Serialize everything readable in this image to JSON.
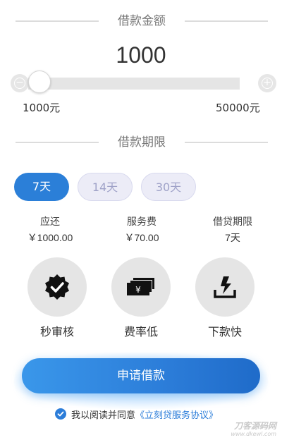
{
  "amount_section": {
    "title": "借款金额",
    "amount": "1000",
    "slider": {
      "min_label": "1000元",
      "max_label": "50000元",
      "min": 1000,
      "max": 50000,
      "value": 1000
    }
  },
  "term_section": {
    "title": "借款期限",
    "options": [
      {
        "label": "7天",
        "selected": true
      },
      {
        "label": "14天",
        "selected": false
      },
      {
        "label": "30天",
        "selected": false
      }
    ]
  },
  "summary": [
    {
      "label": "应还",
      "value": "￥1000.00"
    },
    {
      "label": "服务费",
      "value": "￥70.00"
    },
    {
      "label": "借贷期限",
      "value": "7天"
    }
  ],
  "features": [
    {
      "label": "秒审核",
      "icon": "badge-check-icon"
    },
    {
      "label": "费率低",
      "icon": "banknote-icon"
    },
    {
      "label": "下款快",
      "icon": "lightning-download-icon"
    }
  ],
  "apply_button": {
    "label": "申请借款"
  },
  "agreement": {
    "prefix": "我以阅读并同意",
    "link": "《立刻贷服务协议》"
  },
  "watermark": {
    "main": "刀客源码网",
    "sub": "www.dkewl.com"
  },
  "colors": {
    "accent": "#2b7fd8",
    "pill_inactive_bg": "#ececf7",
    "pill_inactive_text": "#9fa2c8",
    "icon_circle": "#e5e5e5"
  }
}
